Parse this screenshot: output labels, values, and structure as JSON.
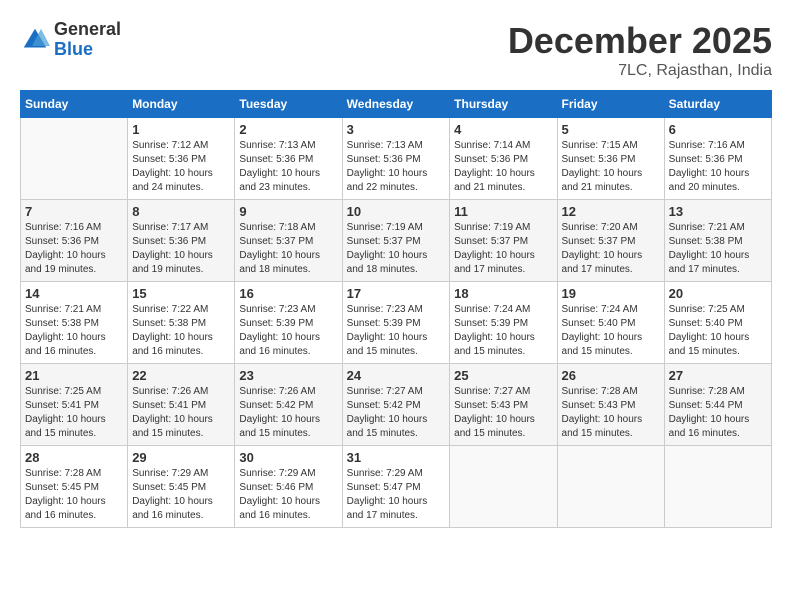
{
  "logo": {
    "general": "General",
    "blue": "Blue"
  },
  "title": "December 2025",
  "location": "7LC, Rajasthan, India",
  "days_of_week": [
    "Sunday",
    "Monday",
    "Tuesday",
    "Wednesday",
    "Thursday",
    "Friday",
    "Saturday"
  ],
  "weeks": [
    [
      {
        "day": "",
        "sunrise": "",
        "sunset": "",
        "daylight": ""
      },
      {
        "day": "1",
        "sunrise": "7:12 AM",
        "sunset": "5:36 PM",
        "daylight": "10 hours and 24 minutes."
      },
      {
        "day": "2",
        "sunrise": "7:13 AM",
        "sunset": "5:36 PM",
        "daylight": "10 hours and 23 minutes."
      },
      {
        "day": "3",
        "sunrise": "7:13 AM",
        "sunset": "5:36 PM",
        "daylight": "10 hours and 22 minutes."
      },
      {
        "day": "4",
        "sunrise": "7:14 AM",
        "sunset": "5:36 PM",
        "daylight": "10 hours and 21 minutes."
      },
      {
        "day": "5",
        "sunrise": "7:15 AM",
        "sunset": "5:36 PM",
        "daylight": "10 hours and 21 minutes."
      },
      {
        "day": "6",
        "sunrise": "7:16 AM",
        "sunset": "5:36 PM",
        "daylight": "10 hours and 20 minutes."
      }
    ],
    [
      {
        "day": "7",
        "sunrise": "7:16 AM",
        "sunset": "5:36 PM",
        "daylight": "10 hours and 19 minutes."
      },
      {
        "day": "8",
        "sunrise": "7:17 AM",
        "sunset": "5:36 PM",
        "daylight": "10 hours and 19 minutes."
      },
      {
        "day": "9",
        "sunrise": "7:18 AM",
        "sunset": "5:37 PM",
        "daylight": "10 hours and 18 minutes."
      },
      {
        "day": "10",
        "sunrise": "7:19 AM",
        "sunset": "5:37 PM",
        "daylight": "10 hours and 18 minutes."
      },
      {
        "day": "11",
        "sunrise": "7:19 AM",
        "sunset": "5:37 PM",
        "daylight": "10 hours and 17 minutes."
      },
      {
        "day": "12",
        "sunrise": "7:20 AM",
        "sunset": "5:37 PM",
        "daylight": "10 hours and 17 minutes."
      },
      {
        "day": "13",
        "sunrise": "7:21 AM",
        "sunset": "5:38 PM",
        "daylight": "10 hours and 17 minutes."
      }
    ],
    [
      {
        "day": "14",
        "sunrise": "7:21 AM",
        "sunset": "5:38 PM",
        "daylight": "10 hours and 16 minutes."
      },
      {
        "day": "15",
        "sunrise": "7:22 AM",
        "sunset": "5:38 PM",
        "daylight": "10 hours and 16 minutes."
      },
      {
        "day": "16",
        "sunrise": "7:23 AM",
        "sunset": "5:39 PM",
        "daylight": "10 hours and 16 minutes."
      },
      {
        "day": "17",
        "sunrise": "7:23 AM",
        "sunset": "5:39 PM",
        "daylight": "10 hours and 15 minutes."
      },
      {
        "day": "18",
        "sunrise": "7:24 AM",
        "sunset": "5:39 PM",
        "daylight": "10 hours and 15 minutes."
      },
      {
        "day": "19",
        "sunrise": "7:24 AM",
        "sunset": "5:40 PM",
        "daylight": "10 hours and 15 minutes."
      },
      {
        "day": "20",
        "sunrise": "7:25 AM",
        "sunset": "5:40 PM",
        "daylight": "10 hours and 15 minutes."
      }
    ],
    [
      {
        "day": "21",
        "sunrise": "7:25 AM",
        "sunset": "5:41 PM",
        "daylight": "10 hours and 15 minutes."
      },
      {
        "day": "22",
        "sunrise": "7:26 AM",
        "sunset": "5:41 PM",
        "daylight": "10 hours and 15 minutes."
      },
      {
        "day": "23",
        "sunrise": "7:26 AM",
        "sunset": "5:42 PM",
        "daylight": "10 hours and 15 minutes."
      },
      {
        "day": "24",
        "sunrise": "7:27 AM",
        "sunset": "5:42 PM",
        "daylight": "10 hours and 15 minutes."
      },
      {
        "day": "25",
        "sunrise": "7:27 AM",
        "sunset": "5:43 PM",
        "daylight": "10 hours and 15 minutes."
      },
      {
        "day": "26",
        "sunrise": "7:28 AM",
        "sunset": "5:43 PM",
        "daylight": "10 hours and 15 minutes."
      },
      {
        "day": "27",
        "sunrise": "7:28 AM",
        "sunset": "5:44 PM",
        "daylight": "10 hours and 16 minutes."
      }
    ],
    [
      {
        "day": "28",
        "sunrise": "7:28 AM",
        "sunset": "5:45 PM",
        "daylight": "10 hours and 16 minutes."
      },
      {
        "day": "29",
        "sunrise": "7:29 AM",
        "sunset": "5:45 PM",
        "daylight": "10 hours and 16 minutes."
      },
      {
        "day": "30",
        "sunrise": "7:29 AM",
        "sunset": "5:46 PM",
        "daylight": "10 hours and 16 minutes."
      },
      {
        "day": "31",
        "sunrise": "7:29 AM",
        "sunset": "5:47 PM",
        "daylight": "10 hours and 17 minutes."
      },
      {
        "day": "",
        "sunrise": "",
        "sunset": "",
        "daylight": ""
      },
      {
        "day": "",
        "sunrise": "",
        "sunset": "",
        "daylight": ""
      },
      {
        "day": "",
        "sunrise": "",
        "sunset": "",
        "daylight": ""
      }
    ]
  ],
  "labels": {
    "sunrise": "Sunrise:",
    "sunset": "Sunset:",
    "daylight": "Daylight:"
  }
}
